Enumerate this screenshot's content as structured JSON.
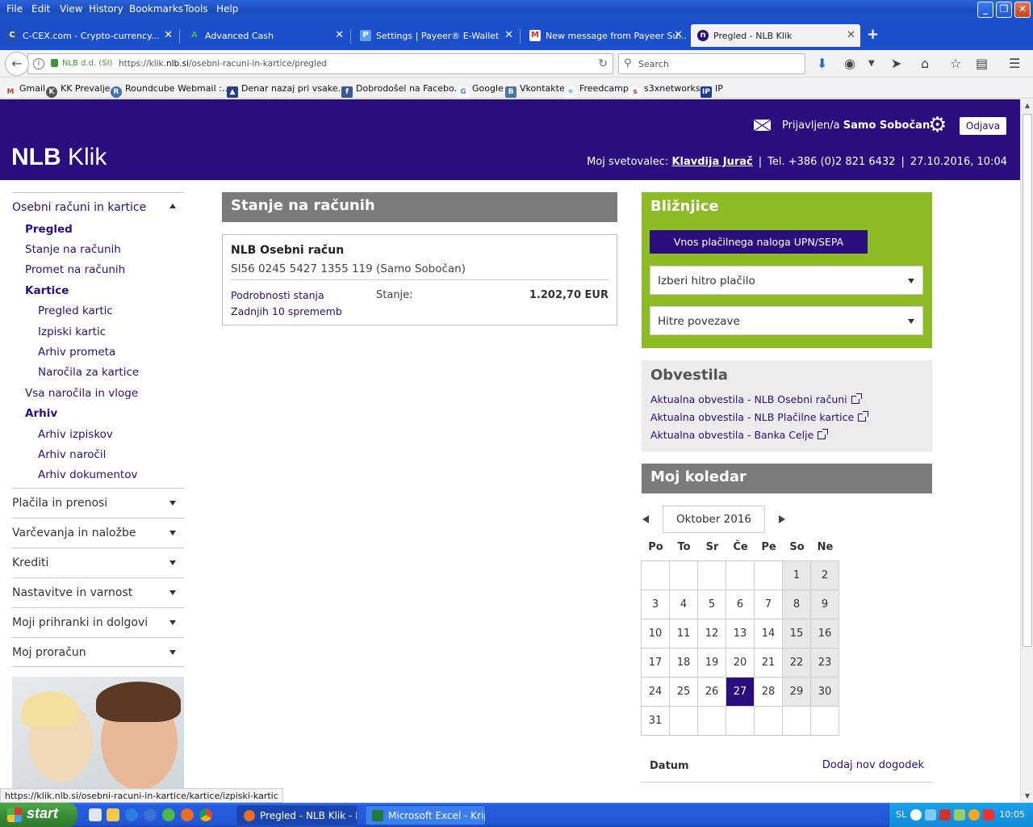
{
  "browser": {
    "menu": [
      "File",
      "Edit",
      "View",
      "History",
      "Bookmarks",
      "Tools",
      "Help"
    ],
    "tabs": [
      {
        "label": "C-CEX.com - Crypto-currency..."
      },
      {
        "label": "Advanced Cash"
      },
      {
        "label": "Settings | Payeer® E-Wallet"
      },
      {
        "label": "New message from Payeer Su..."
      },
      {
        "label": "Pregled - NLB Klik",
        "active": true
      }
    ],
    "url_org": "NLB d.d. (SI)",
    "url_prefix": "https://klik.",
    "url_host": "nlb.si",
    "url_path": "/osebni-racuni-in-kartice/pregled",
    "search_placeholder": "Search",
    "bookmarks": [
      "Gmail",
      "KK Prevalje",
      "Roundcube Webmail :...",
      "Denar nazaj pri vsake...",
      "Dobrodošel na Facebo...",
      "Google",
      "Vkontakte",
      "Freedcamp",
      "s3xnetworks",
      "IP"
    ],
    "status_url": "https://klik.nlb.si/osebni-racuni-in-kartice/kartice/izpiski-kartic"
  },
  "header": {
    "logo_bold": "NLB",
    "logo_light": "Klik",
    "logged_prefix": "Prijavljen/a",
    "user_name": "Samo Sobočan",
    "logout": "Odjava",
    "advisor_label": "Moj svetovalec:",
    "advisor_name": "Klavdija Jurač",
    "phone": "Tel. +386 (0)2 821 6432",
    "datetime": "27.10.2016, 10:04"
  },
  "leftnav": {
    "section_open": "Osebni računi in kartice",
    "sub": {
      "pregled": "Pregled",
      "stanje": "Stanje na računih",
      "promet": "Promet na računih",
      "kartice": "Kartice",
      "pregled_kartic": "Pregled kartic",
      "izpiski_kartic": "Izpiski kartic",
      "arhiv_prometa": "Arhiv prometa",
      "narocila_kartice": "Naročila za kartice",
      "vsa_narocila": "Vsa naročila in vloge",
      "arhiv": "Arhiv",
      "arhiv_izpiskov": "Arhiv izpiskov",
      "arhiv_narocil": "Arhiv naročil",
      "arhiv_dokumentov": "Arhiv dokumentov"
    },
    "sections": [
      "Plačila in prenosi",
      "Varčevanja in naložbe",
      "Krediti",
      "Nastavitve in varnost",
      "Moji prihranki in dolgovi",
      "Moj proračun"
    ]
  },
  "main": {
    "title": "Stanje na računih",
    "account": {
      "name": "NLB Osebni račun",
      "iban": "SI56 0245 5427 1355 119 (Samo Sobočan)",
      "link_details": "Podrobnosti stanja",
      "link_last10": "Zadnjih 10 sprememb",
      "balance_label": "Stanje:",
      "balance": "1.202,70 EUR"
    }
  },
  "shortcuts": {
    "title": "Bližnjice",
    "upn_button": "Vnos plačilnega naloga UPN/SEPA",
    "quick_payment": "Izberi hitro plačilo",
    "quick_links": "Hitre povezave"
  },
  "notices": {
    "title": "Obvestila",
    "items": [
      "Aktualna obvestila - NLB Osebni računi",
      "Aktualna obvestila - NLB Plačilne kartice",
      "Aktualna obvestila - Banka Celje"
    ]
  },
  "calendar": {
    "title": "Moj koledar",
    "month": "Oktober 2016",
    "weekdays": [
      "Po",
      "To",
      "Sr",
      "Če",
      "Pe",
      "So",
      "Ne"
    ],
    "today": 27,
    "date_label": "Datum",
    "add_event": "Dodaj nov dogodek"
  },
  "taskbar": {
    "start": "start",
    "items": [
      {
        "label": "Pregled - NLB Klik - M...",
        "active": true
      },
      {
        "label": "Microsoft Excel - Kript..."
      }
    ],
    "lang": "SL",
    "clock": "10:05"
  },
  "colors": {
    "brand": "#2a0e7e",
    "shortcut_bg": "#8dbb24",
    "section_head": "#7b7b7b"
  }
}
